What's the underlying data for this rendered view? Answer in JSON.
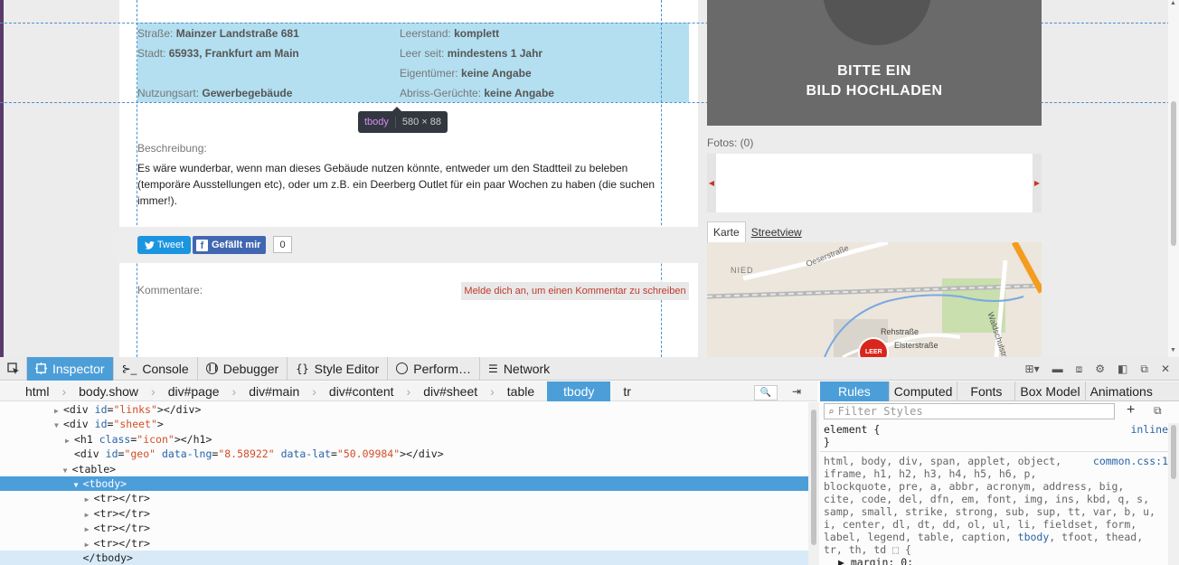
{
  "page": {
    "table": [
      {
        "left_label": "Straße:",
        "left_value": "Mainzer Landstraße 681",
        "right_label": "Leerstand:",
        "right_value": "komplett"
      },
      {
        "left_label": "Stadt:",
        "left_value": "65933, Frankfurt am Main",
        "right_label": "Leer seit:",
        "right_value": "mindestens 1 Jahr"
      },
      {
        "left_label": "",
        "left_value": "",
        "right_label": "Eigentümer:",
        "right_value": "keine Angabe"
      },
      {
        "left_label": "Nutzungsart:",
        "left_value": "Gewerbegebäude",
        "right_label": "Abriss-Gerüchte:",
        "right_value": "keine Angabe"
      }
    ],
    "tooltip": {
      "tag": "tbody",
      "size": "580 × 88"
    },
    "description_label": "Beschreibung:",
    "description_text": "Es wäre wunderbar, wenn man dieses Gebäude nutzen könnte, entweder um den Stadtteil zu beleben (temporäre Ausstellungen etc), oder um z.B. ein Deerberg Outlet für ein paar Wochen zu haben (die suchen immer!).",
    "tweet_label": "Tweet",
    "like_label": "Gefällt mir",
    "like_count": "0",
    "comments_label": "Kommentare:",
    "login_prompt": "Melde dich an, um einen Kommentar zu schreiben",
    "image_placeholder_line1": "BITTE EIN",
    "image_placeholder_line2": "BILD HOCHLADEN",
    "photos_label": "Fotos: (0)",
    "map_tabs": [
      "Karte",
      "Streetview"
    ],
    "map_labels": {
      "nied": "NIED",
      "street1": "Oeserstraße",
      "street2": "Rehstraße",
      "street3": "Elsterstraße",
      "street4": "Waldschulstraße",
      "marker": "LEER"
    }
  },
  "devtools": {
    "tabs": [
      {
        "label": "Inspector",
        "icon": "gear-icon",
        "selected": true
      },
      {
        "label": "Console",
        "icon": "console-icon",
        "selected": false
      },
      {
        "label": "Debugger",
        "icon": "debugger-icon",
        "selected": false
      },
      {
        "label": "Style Editor",
        "icon": "braces-icon",
        "selected": false
      },
      {
        "label": "Perform…",
        "icon": "performance-icon",
        "selected": false
      },
      {
        "label": "Network",
        "icon": "network-icon",
        "selected": false
      }
    ],
    "breadcrumbs": [
      "html",
      "body.show",
      "div#page",
      "div#main",
      "div#content",
      "div#sheet",
      "table",
      "tbody",
      "tr"
    ],
    "selected_crumb": "tbody",
    "markup": [
      {
        "indent": 5,
        "twisty": "▶",
        "tag": "div",
        "attrs": [
          [
            "id",
            "links"
          ]
        ],
        "close": "</div>",
        "state": ""
      },
      {
        "indent": 5,
        "twisty": "▼",
        "tag": "div",
        "attrs": [
          [
            "id",
            "sheet"
          ]
        ],
        "close": "",
        "state": ""
      },
      {
        "indent": 6,
        "twisty": "▶",
        "tag": "h1",
        "attrs": [
          [
            "class",
            "icon"
          ]
        ],
        "close": "</h1>",
        "state": ""
      },
      {
        "indent": 6,
        "twisty": "",
        "tag": "div",
        "attrs": [
          [
            "id",
            "geo"
          ],
          [
            "data-lng",
            "8.58922"
          ],
          [
            "data-lat",
            "50.09984"
          ]
        ],
        "close": "</div>",
        "state": ""
      },
      {
        "indent": 5.8,
        "twisty": "▼",
        "tag": "table",
        "attrs": [],
        "close": "",
        "state": ""
      },
      {
        "indent": 6.8,
        "twisty": "▼",
        "tag": "tbody",
        "attrs": [],
        "close": "",
        "state": "sel"
      },
      {
        "indent": 7.8,
        "twisty": "▶",
        "tag": "tr",
        "attrs": [],
        "close": "</tr>",
        "state": ""
      },
      {
        "indent": 7.8,
        "twisty": "▶",
        "tag": "tr",
        "attrs": [],
        "close": "</tr>",
        "state": ""
      },
      {
        "indent": 7.8,
        "twisty": "▶",
        "tag": "tr",
        "attrs": [],
        "close": "</tr>",
        "state": ""
      },
      {
        "indent": 7.8,
        "twisty": "▶",
        "tag": "tr",
        "attrs": [],
        "close": "</tr>",
        "state": ""
      },
      {
        "indent": 6.8,
        "twisty": "",
        "tag": "/tbody",
        "attrs": [],
        "close": "",
        "state": "hov"
      }
    ],
    "side_tabs": [
      "Rules",
      "Computed",
      "Fonts",
      "Box Model",
      "Animations"
    ],
    "filter_placeholder": "Filter Styles",
    "rule1_selector": "element {",
    "rule1_source": "inline",
    "rule1_close": "}",
    "rule2_source": "common.css:1",
    "rule2_lines": [
      "html, body, div, span, applet, object,",
      "iframe, h1, h2, h3, h4, h5, h6, p,",
      "blockquote, pre, a, abbr, acronym, address, big,",
      "cite, code, del, dfn, em, font, img, ins, kbd, q, s,",
      "samp, small, strike, strong, sub, sup, tt, var, b, u,",
      "i, center, dl, dt, dd, ol, ul, li, fieldset, form,",
      "label, legend, table, caption, tbody, tfoot, thead,",
      "tr, th, td ⬚ {",
      "  ▶ margin: 0;"
    ]
  },
  "colors": {
    "accent": "#4c9ed9",
    "tbody_highlight": "#b3dff0",
    "tweet": "#1b95e0",
    "facebook": "#4267b2",
    "login_text": "#c0392b"
  }
}
